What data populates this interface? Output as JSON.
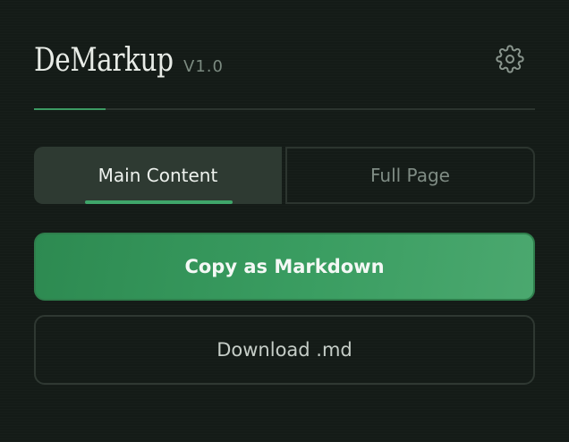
{
  "header": {
    "title": "DeMarkup",
    "version": "V1.0",
    "settings_icon": "gear-icon"
  },
  "tabs": [
    {
      "label": "Main Content",
      "selected": true
    },
    {
      "label": "Full Page",
      "selected": false
    }
  ],
  "actions": {
    "copy_label": "Copy as Markdown",
    "download_label": "Download .md"
  },
  "colors": {
    "background": "#141b17",
    "accent": "#3fa66a",
    "primary_button": "#3a9d61",
    "text_primary": "#eef2ee",
    "text_muted": "#7f8c84"
  }
}
